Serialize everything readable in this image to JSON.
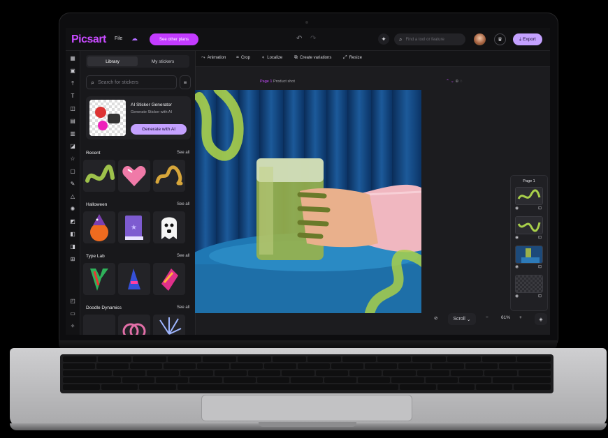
{
  "app": {
    "logo": "Picsart",
    "file_menu": "File",
    "offer_button": "See other plans",
    "search_placeholder": "Find a tool or feature",
    "export_label": "Export"
  },
  "panel": {
    "tabs": [
      "Library",
      "My stickers"
    ],
    "search_placeholder": "Search for stickers",
    "generator": {
      "title": "AI Sticker Generator",
      "subtitle": "Generate Sticker with AI",
      "button": "Generate with AI"
    },
    "sections": [
      {
        "title": "Recent",
        "see_all": "See all"
      },
      {
        "title": "Halloween",
        "see_all": "See all"
      },
      {
        "title": "Type Lab",
        "see_all": "See all"
      },
      {
        "title": "Doodle Dynamics",
        "see_all": "See all"
      }
    ]
  },
  "canvas_toolbar": [
    {
      "label": "Animation",
      "icon": "animation-icon"
    },
    {
      "label": "Crop",
      "icon": "crop-icon"
    },
    {
      "label": "Localize",
      "icon": "globe-icon"
    },
    {
      "label": "Create variations",
      "icon": "variations-icon"
    },
    {
      "label": "Resize",
      "icon": "resize-icon"
    }
  ],
  "canvas": {
    "page_prefix": "Page 1",
    "page_name": "Product shot"
  },
  "pages_panel": {
    "title": "Page 1"
  },
  "bottom": {
    "scroll_label": "Scroll",
    "zoom": "61%"
  },
  "colors": {
    "brand": "#c84bff",
    "accent_button": "#c4a1ff",
    "background": "#141416"
  }
}
